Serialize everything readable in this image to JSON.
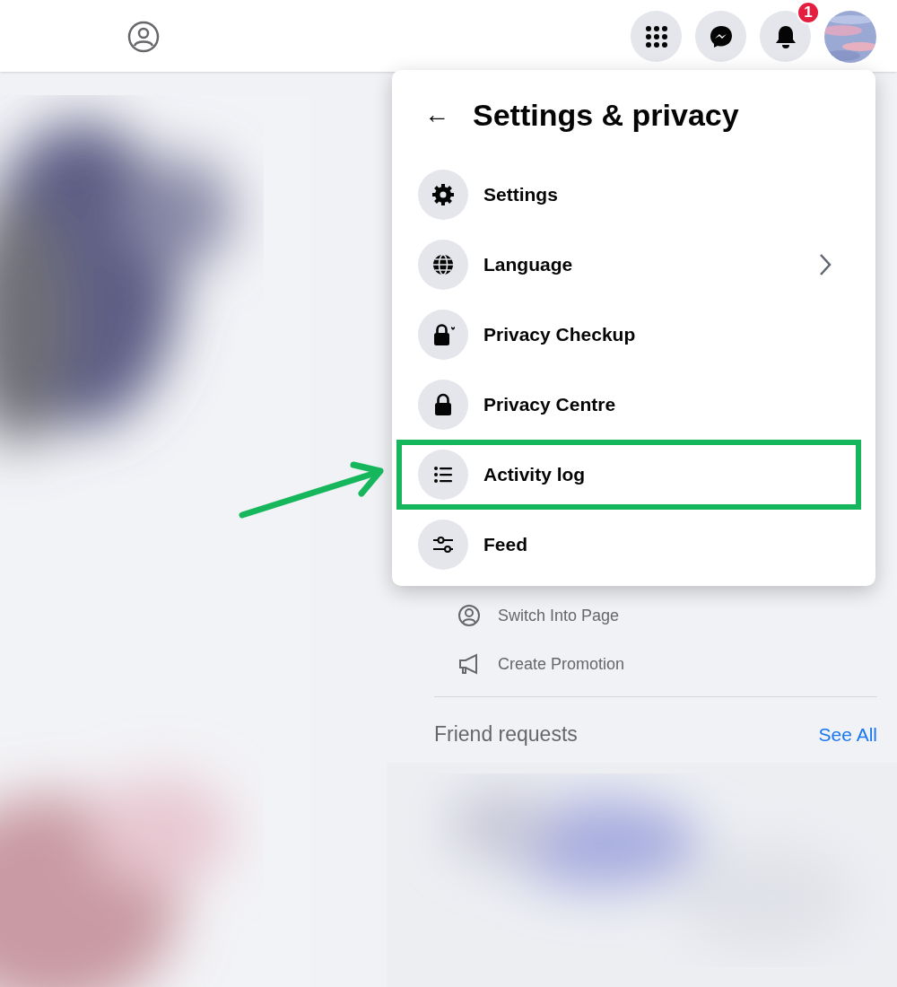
{
  "header": {
    "notification_count": "1"
  },
  "menu": {
    "title": "Settings & privacy",
    "back": "←",
    "items": [
      {
        "label": "Settings",
        "has_submenu": false,
        "highlighted": false
      },
      {
        "label": "Language",
        "has_submenu": true,
        "highlighted": false
      },
      {
        "label": "Privacy Checkup",
        "has_submenu": false,
        "highlighted": false
      },
      {
        "label": "Privacy Centre",
        "has_submenu": false,
        "highlighted": false
      },
      {
        "label": "Activity log",
        "has_submenu": false,
        "highlighted": true
      },
      {
        "label": "Feed",
        "has_submenu": false,
        "highlighted": false
      }
    ]
  },
  "shortcuts": [
    {
      "label": "Switch Into Page"
    },
    {
      "label": "Create Promotion"
    }
  ],
  "friend_requests": {
    "title": "Friend requests",
    "link": "See All"
  }
}
